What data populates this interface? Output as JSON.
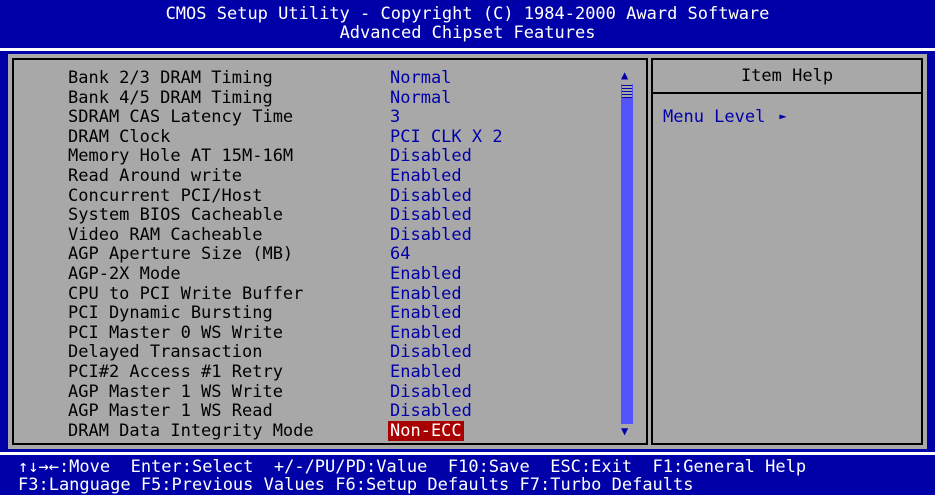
{
  "header": {
    "line1": "CMOS Setup Utility - Copyright (C) 1984-2000 Award Software",
    "line2": "Advanced Chipset Features"
  },
  "settings": [
    {
      "label": "Bank 2/3 DRAM Timing",
      "value": "Normal"
    },
    {
      "label": "Bank 4/5 DRAM Timing",
      "value": "Normal"
    },
    {
      "label": "SDRAM CAS Latency Time",
      "value": "3"
    },
    {
      "label": "DRAM Clock",
      "value": "PCI CLK X 2"
    },
    {
      "label": "Memory Hole AT 15M-16M",
      "value": "Disabled"
    },
    {
      "label": "Read Around write",
      "value": "Enabled"
    },
    {
      "label": "Concurrent PCI/Host",
      "value": "Disabled"
    },
    {
      "label": "System BIOS Cacheable",
      "value": "Disabled"
    },
    {
      "label": "Video RAM Cacheable",
      "value": "Disabled"
    },
    {
      "label": "AGP Aperture Size (MB)",
      "value": "64"
    },
    {
      "label": "AGP-2X Mode",
      "value": "Enabled"
    },
    {
      "label": "CPU to PCI Write Buffer",
      "value": "Enabled"
    },
    {
      "label": "PCI Dynamic Bursting",
      "value": "Enabled"
    },
    {
      "label": "PCI Master 0 WS Write",
      "value": "Enabled"
    },
    {
      "label": "Delayed Transaction",
      "value": "Disabled"
    },
    {
      "label": "PCI#2 Access #1 Retry",
      "value": "Enabled"
    },
    {
      "label": "AGP Master 1 WS Write",
      "value": "Disabled"
    },
    {
      "label": "AGP Master 1 WS Read",
      "value": "Disabled"
    },
    {
      "label": "DRAM Data Integrity Mode",
      "value": "Non-ECC",
      "selected": true
    }
  ],
  "help": {
    "title": "Item Help",
    "menu_level_label": "Menu Level",
    "menu_level_icon": "right-triangle-icon"
  },
  "footer": {
    "line1": "↑↓→←:Move  Enter:Select  +/-/PU/PD:Value  F10:Save  ESC:Exit  F1:General Help",
    "line2": "F3:Language F5:Previous Values F6:Setup Defaults F7:Turbo Defaults"
  },
  "colors": {
    "background": "#0000a8",
    "panel": "#a8a8a8",
    "value_text": "#0000a8",
    "selected_bg": "#a80000",
    "header_text": "#ffffff"
  }
}
